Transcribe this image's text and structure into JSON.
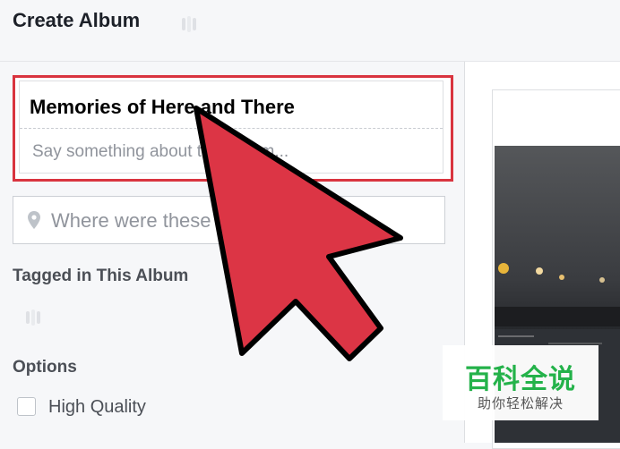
{
  "header": {
    "title": "Create Album"
  },
  "album": {
    "name": "Memories of Here and There",
    "description_placeholder": "Say something about this album..."
  },
  "location": {
    "placeholder": "Where were these taken?"
  },
  "tagged": {
    "heading": "Tagged in This Album"
  },
  "options": {
    "heading": "Options",
    "high_quality_label": "High Quality",
    "high_quality_checked": false
  },
  "watermark": {
    "title": "百科全说",
    "subtitle": "助你轻松解决"
  },
  "colors": {
    "highlight_border": "#d9343f",
    "arrow_fill": "#dc3545",
    "watermark_green": "#24b24a"
  },
  "icons": {
    "location": "map-pin-icon",
    "loading": "loading-spinner-icon",
    "cursor": "arrow-pointer-icon"
  }
}
